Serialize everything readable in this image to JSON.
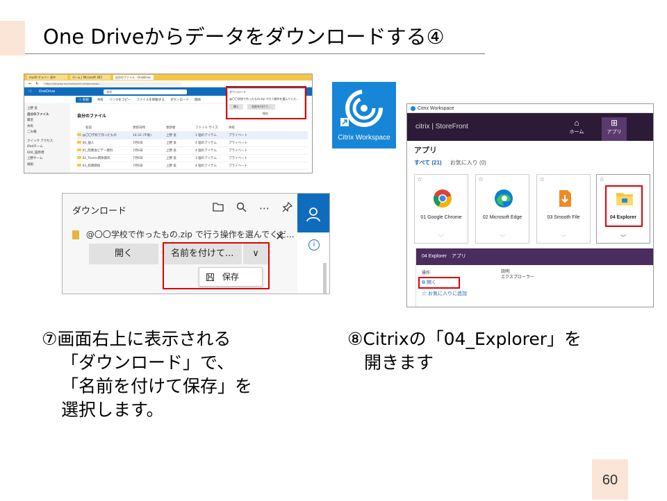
{
  "slide": {
    "title": "One Driveからデータをダウンロードする④",
    "page_number": "60"
  },
  "onedrive": {
    "tab1": "mu00 ボラバー 表中",
    "tab2": "ホーム | Microsoft 365",
    "tab3": "自分のファイル - OneDrive",
    "url": "https://eduplay.my.sharepoint.com/personal/...",
    "app_name": "OneDrive",
    "search_placeholder": "検索",
    "cmd_new": "＋ 新規",
    "cmd_share": "共有",
    "cmd_copylink": "リンクをコピー",
    "cmd_move": "ファイルを移動する",
    "cmd_download": "ダウンロード",
    "cmd_delete": "削除",
    "sidebar": [
      "上野 良",
      "自分のファイル",
      "最近",
      "共有",
      "ごみ箱",
      "クイック アクセス",
      "iPadチーム",
      "000_田原港",
      "上野チーム",
      "様組"
    ],
    "heading": "自分のファイル",
    "col_name": "名前",
    "col_modified": "更新日時",
    "col_owner": "更新者",
    "col_size": "ファイル サイズ",
    "col_share": "共有",
    "rows": [
      {
        "name": "@〇〇学校で作ったもの",
        "modified": "14:31 (午後)",
        "owner": "上野 良",
        "size": "1 個のアイテム",
        "share": "プライベート"
      },
      {
        "name": "00_個人",
        "modified": "7月6日",
        "owner": "上野 良",
        "size": "4 個のアイテム",
        "share": "プライベート"
      },
      {
        "name": "01_院務会ビデー資料",
        "modified": "7月6日",
        "owner": "上野 良",
        "size": "4 個のアイテム",
        "share": "プライベート"
      },
      {
        "name": "02_Teams関係資料",
        "modified": "7月6日",
        "owner": "上野 良",
        "size": "3 個のアイテム",
        "share": "プライベート"
      },
      {
        "name": "03_校務関係",
        "modified": "7月6日",
        "owner": "上野 良",
        "size": "4 個のアイテム",
        "share": "プライベート"
      }
    ],
    "popup_title": "ダウンロード",
    "popup_text": "@〇〇学校で作ったもの.zip で行う操作を選んでくだ...",
    "popup_open": "開く",
    "popup_saveas": "名前を付けて...",
    "popup_save": "保存"
  },
  "citrix_icon": {
    "label": "Citrix Workspace",
    "color": "#1786d6"
  },
  "download_panel": {
    "title": "ダウンロード",
    "folder_icon": "folder-icon",
    "search_icon": "search-icon",
    "more_icon": "⋯",
    "pin_icon": "pin-icon",
    "file_text": "@〇〇学校で作ったもの.zip で行う操作を選んでくだ...",
    "open_button": "開く",
    "saveas_button": "名前を付けて...",
    "dropdown_glyph": "∨",
    "close_glyph": "✕",
    "save_item": "保存",
    "info_glyph": "i",
    "accent": "#0f6cbd"
  },
  "storefront": {
    "window_title": "Citrix Workspace",
    "logo": "citrix | StoreFront",
    "nav_home": "ホーム",
    "nav_apps": "アプリ",
    "heading": "アプリ",
    "filter_all": "すべて (21)",
    "filter_fav": "お気に入り (0)",
    "tiles": [
      "01 Google Chrome",
      "02 Microsoft Edge",
      "03 Smooth File",
      "04 Explorer"
    ],
    "detail_title": "04 Explorer　アプリ",
    "ops_label": "操作:",
    "desc_label": "説明:",
    "desc_value": "エクスプローラー",
    "action_open": "開く",
    "action_fav": "お気に入りに追加",
    "header_color": "#2c1a36"
  },
  "captions": {
    "left_line1": "⑦画面右上に表示される",
    "left_line2": "「ダウンロード」で、",
    "left_line3": "「名前を付けて保存」を",
    "left_line4": "選択します。",
    "right_line1": "⑧Citrixの「04_Explorer」を",
    "right_line2": "開きます"
  }
}
